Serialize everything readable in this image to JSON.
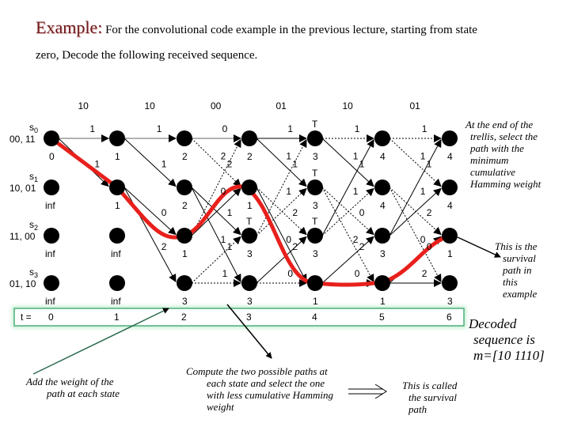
{
  "title": {
    "label": "Example:",
    "line1": "For the convolutional code example in the previous lecture, starting from state",
    "line2": "zero, Decode the following received sequence."
  },
  "trellis": {
    "received": [
      "10",
      "10",
      "00",
      "01",
      "10",
      "01"
    ],
    "states": [
      {
        "name": "s",
        "sub": "0",
        "outputs": "00, 11"
      },
      {
        "name": "s",
        "sub": "1",
        "outputs": "10, 01"
      },
      {
        "name": "s",
        "sub": "2",
        "outputs": "11, 00"
      },
      {
        "name": "s",
        "sub": "3",
        "outputs": "01, 10"
      }
    ],
    "metrics": [
      [
        "0",
        "inf",
        "inf",
        "inf"
      ],
      [
        "1",
        "1",
        "inf",
        "inf"
      ],
      [
        "2",
        "2",
        "1",
        "3"
      ],
      [
        "2",
        "1",
        "3",
        "3"
      ],
      [
        "3",
        "3",
        "3",
        "1"
      ],
      [
        "4",
        "4",
        "3",
        "1"
      ],
      [
        "4",
        "4",
        "1",
        "3"
      ]
    ],
    "time_label": "t =",
    "times": [
      "0",
      "1",
      "2",
      "3",
      "4",
      "5",
      "6"
    ],
    "tie_marker": "T",
    "colors": {
      "survivor_path": "#e8201c",
      "time_box_border": "#4caf7a",
      "time_box_glow": "#c8f0d4",
      "arrow_green": "#2e6b4f",
      "title_accent": "#6b1a1a"
    }
  },
  "notes": {
    "end_of_trellis": [
      "At the end of the",
      "trellis, select the",
      "path with the",
      "minimum",
      "cumulative",
      "Hamming weight"
    ],
    "survival_example": [
      "This is the",
      "survival",
      "path in",
      "this",
      "example"
    ],
    "decoded": [
      "Decoded",
      "sequence is",
      "m=[10 1110]"
    ],
    "add_weight": [
      "Add the weight of the",
      "path at each state"
    ],
    "compute_paths": [
      "Compute the two possible paths at",
      "each state and select the one",
      "with less cumulative Hamming",
      "weight"
    ],
    "called_survival": [
      "This is called",
      "the survival",
      "path"
    ]
  }
}
